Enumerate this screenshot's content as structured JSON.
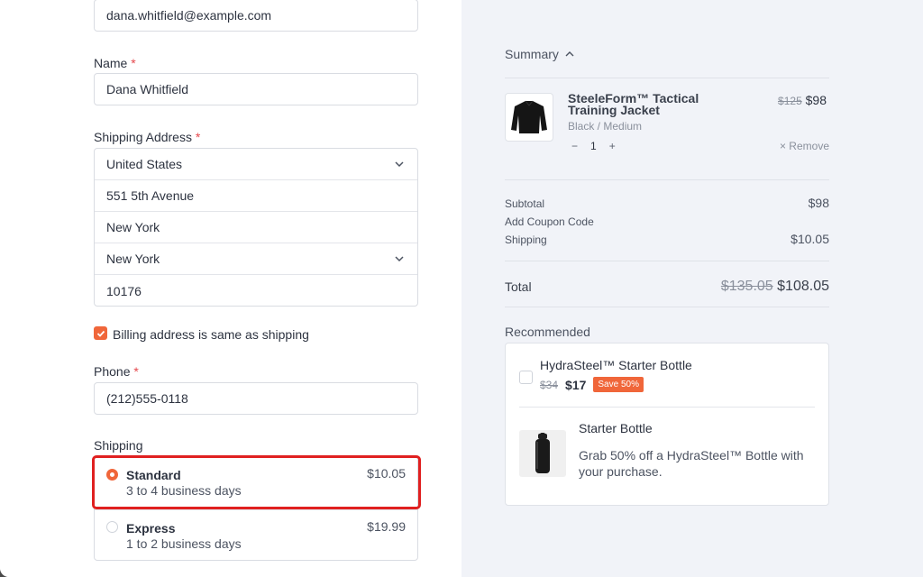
{
  "form": {
    "email_value": "dana.whitfield@example.com",
    "name_label": "Name",
    "required_mark": "*",
    "name_value": "Dana Whitfield",
    "address_label": "Shipping Address",
    "address": {
      "country": "United States",
      "street": "551 5th Avenue",
      "city": "New York",
      "state": "New York",
      "zip": "10176"
    },
    "billing_same_label": "Billing address is same as shipping",
    "phone_label": "Phone",
    "phone_value": "(212)555-0118",
    "shipping_label": "Shipping",
    "shipping_options": [
      {
        "name": "Standard",
        "detail": "3 to 4 business days",
        "price": "$10.05",
        "selected": true
      },
      {
        "name": "Express",
        "detail": "1 to 2 business days",
        "price": "$19.99",
        "selected": false
      }
    ]
  },
  "summary": {
    "heading": "Summary",
    "item": {
      "name": "SteeleForm™ Tactical Training Jacket",
      "variant": "Black / Medium",
      "quantity": "1",
      "qty_minus": "−",
      "qty_plus": "+",
      "old_price": "$125",
      "price": "$98",
      "remove_label": "× Remove"
    },
    "subtotal_label": "Subtotal",
    "subtotal_value": "$98",
    "coupon_label": "Add Coupon Code",
    "shipping_label": "Shipping",
    "shipping_value": "$10.05",
    "total_label": "Total",
    "total_old": "$135.05",
    "total_value": "$108.05"
  },
  "recommended": {
    "heading": "Recommended",
    "item_name": "HydraSteel™ Starter Bottle",
    "old_price": "$34",
    "price": "$17",
    "badge": "Save 50%",
    "promo_title": "Starter Bottle",
    "promo_desc": "Grab 50% off a HydraSteel™ Bottle with your purchase."
  },
  "colors": {
    "accent": "#f0663a",
    "highlight": "#e02020",
    "panel": "#f1f3f8"
  }
}
